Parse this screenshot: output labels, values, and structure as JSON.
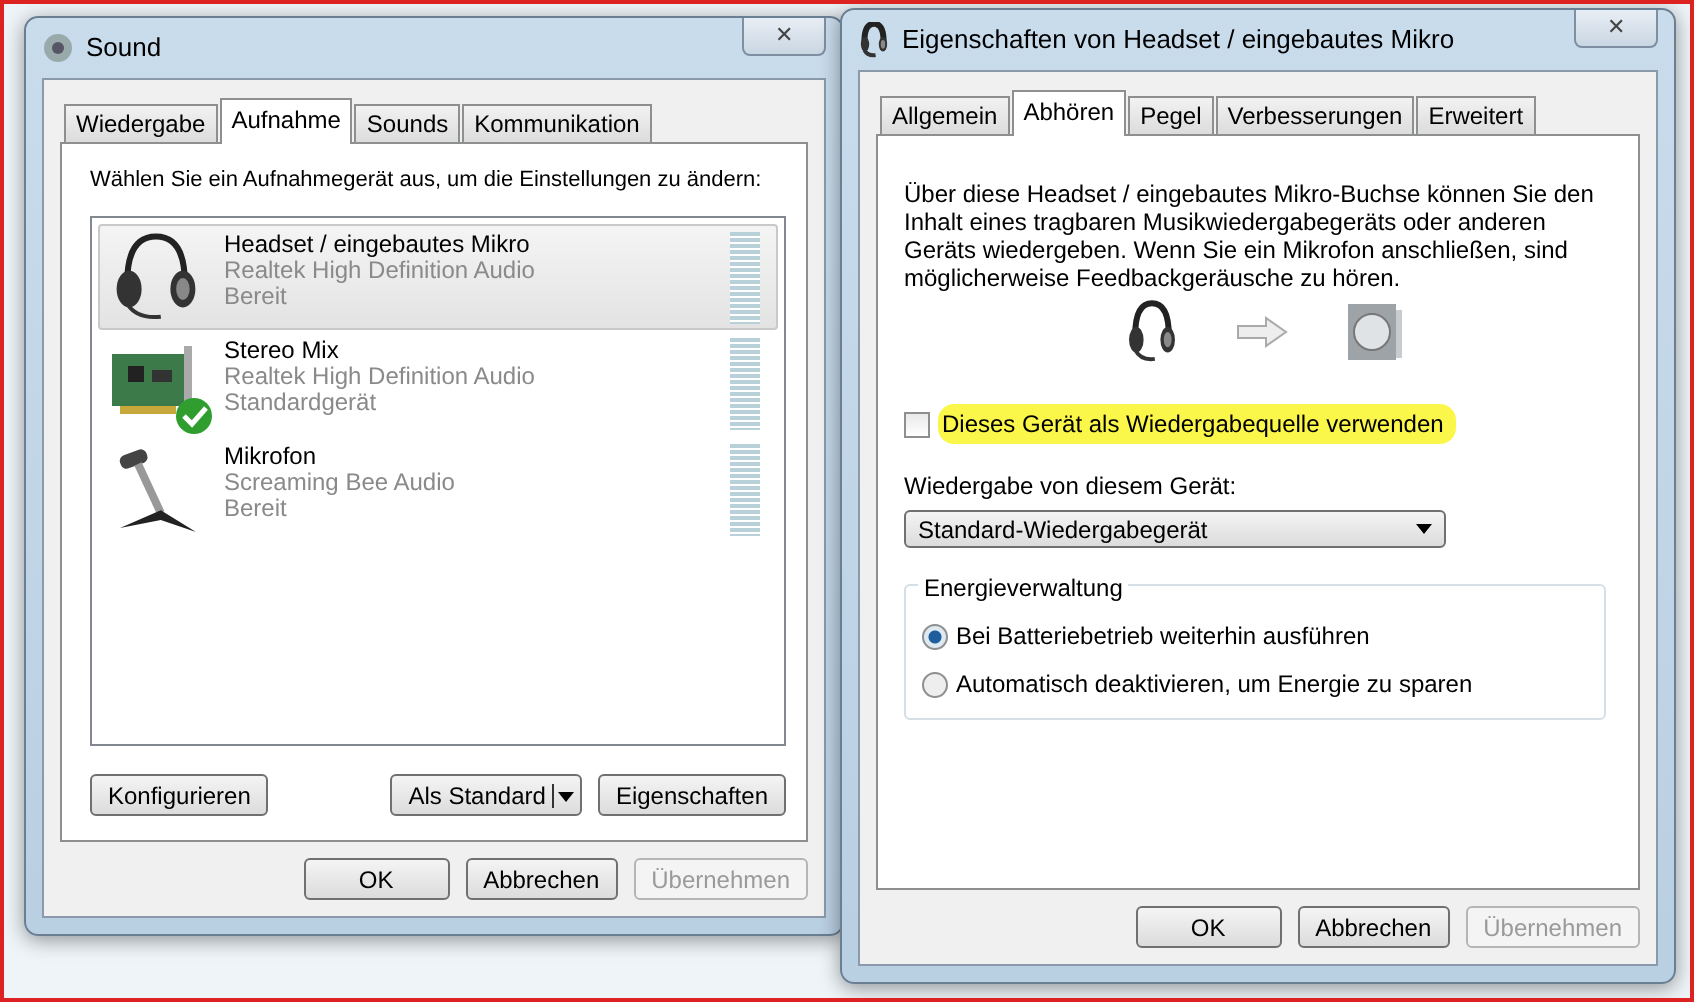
{
  "sound_window": {
    "title": "Sound",
    "close": "✕",
    "tabs": [
      {
        "label": "Wiedergabe",
        "selected": false
      },
      {
        "label": "Aufnahme",
        "selected": true
      },
      {
        "label": "Sounds",
        "selected": false
      },
      {
        "label": "Kommunikation",
        "selected": false
      }
    ],
    "instruction": "Wählen Sie ein Aufnahmegerät aus, um die Einstellungen zu ändern:",
    "devices": [
      {
        "kind": "headset",
        "name": "Headset / eingebautes Mikro",
        "driver": "Realtek High Definition Audio",
        "status": "Bereit",
        "default": false,
        "selected": true
      },
      {
        "kind": "card",
        "name": "Stereo Mix",
        "driver": "Realtek High Definition Audio",
        "status": "Standardgerät",
        "default": true,
        "selected": false
      },
      {
        "kind": "microphone",
        "name": "Mikrofon",
        "driver": "Screaming Bee Audio",
        "status": "Bereit",
        "default": false,
        "selected": false
      }
    ],
    "configure_button": "Konfigurieren",
    "default_button": "Als Standard",
    "properties_button": "Eigenschaften",
    "dialog_buttons": [
      {
        "label": "OK",
        "disabled": false
      },
      {
        "label": "Abbrechen",
        "disabled": false
      },
      {
        "label": "Übernehmen",
        "disabled": true
      }
    ]
  },
  "properties_window": {
    "title": "Eigenschaften von Headset / eingebautes Mikro",
    "close": "✕",
    "tabs": [
      {
        "label": "Allgemein",
        "selected": false
      },
      {
        "label": "Abhören",
        "selected": true
      },
      {
        "label": "Pegel",
        "selected": false
      },
      {
        "label": "Verbesserungen",
        "selected": false
      },
      {
        "label": "Erweitert",
        "selected": false
      }
    ],
    "description": "Über diese Headset / eingebautes Mikro-Buchse können Sie den Inhalt eines tragbaren Musikwiedergabegeräts oder anderen Geräts wiedergeben. Wenn Sie ein Mikrofon anschließen, sind möglicherweise Feedbackgeräusche zu hören.",
    "listen_checkbox": {
      "label": "Dieses Gerät als Wiedergabequelle verwenden",
      "checked": false,
      "highlighted": true
    },
    "playback_label": "Wiedergabe von diesem Gerät:",
    "playback_select": "Standard-Wiedergabegerät",
    "power_group": {
      "title": "Energieverwaltung",
      "options": [
        {
          "label": "Bei Batteriebetrieb weiterhin ausführen",
          "selected": true
        },
        {
          "label": "Automatisch deaktivieren, um Energie zu sparen",
          "selected": false
        }
      ]
    },
    "dialog_buttons": [
      {
        "label": "OK",
        "disabled": false
      },
      {
        "label": "Abbrechen",
        "disabled": false
      },
      {
        "label": "Übernehmen",
        "disabled": true
      }
    ]
  }
}
